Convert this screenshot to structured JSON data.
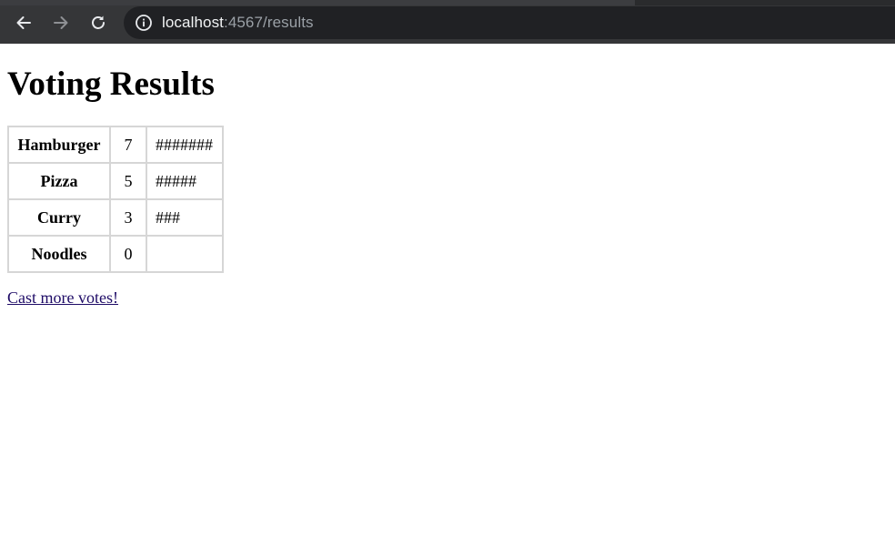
{
  "browser": {
    "url_host": "localhost",
    "url_rest": ":4567/results"
  },
  "page": {
    "title": "Voting Results",
    "link_label": "Cast more votes!"
  },
  "results": [
    {
      "food": "Hamburger",
      "count": "7",
      "bar": "#######"
    },
    {
      "food": "Pizza",
      "count": "5",
      "bar": "#####"
    },
    {
      "food": "Curry",
      "count": "3",
      "bar": "###"
    },
    {
      "food": "Noodles",
      "count": "0",
      "bar": ""
    }
  ]
}
